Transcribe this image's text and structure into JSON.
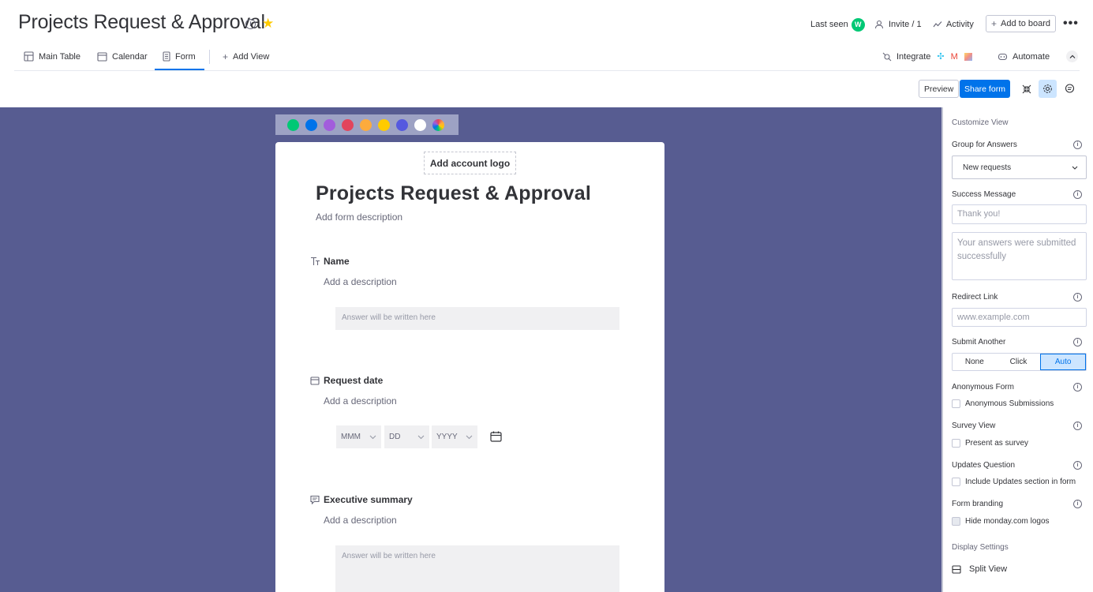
{
  "header": {
    "title": "Projects Request & Approval",
    "last_seen_label": "Last seen",
    "avatar_initial": "W",
    "invite_label": "Invite / 1",
    "activity_label": "Activity",
    "add_to_board_label": "Add to board",
    "more_label": "•••"
  },
  "tabs": [
    {
      "label": "Main Table",
      "icon": "table-icon"
    },
    {
      "label": "Calendar",
      "icon": "calendar-icon"
    },
    {
      "label": "Form",
      "icon": "form-icon",
      "active": true
    },
    {
      "label": "Add View",
      "icon": "plus-icon"
    }
  ],
  "toolbar": {
    "integrate_label": "Integrate",
    "automate_label": "Automate",
    "preview_label": "Preview",
    "share_label": "Share form"
  },
  "palette": {
    "colors": [
      "#00c875",
      "#0073ea",
      "#a25ddc",
      "#e2445c",
      "#fdab3d",
      "#ffcb00",
      "#5559df",
      "#ffffff"
    ]
  },
  "form": {
    "logo_label": "Add account logo",
    "title": "Projects Request & Approval",
    "description": "Add form description",
    "questions": [
      {
        "label": "Name",
        "description": "Add a description",
        "placeholder": "Answer will be written here"
      },
      {
        "label": "Request date",
        "description": "Add a description",
        "month": "MMM",
        "day": "DD",
        "year": "YYYY"
      },
      {
        "label": "Executive summary",
        "description": "Add a description",
        "placeholder": "Answer will be written here"
      }
    ]
  },
  "panel": {
    "customize_title": "Customize View",
    "group_label": "Group for Answers",
    "group_value": "New requests",
    "success_label": "Success Message",
    "success_title_placeholder": "Thank you!",
    "success_body_placeholder": "Your answers were submitted successfully",
    "redirect_label": "Redirect Link",
    "redirect_placeholder": "www.example.com",
    "submit_another_label": "Submit Another",
    "submit_options": [
      "None",
      "Click",
      "Auto"
    ],
    "submit_selected": "Auto",
    "anonymous_label": "Anonymous Form",
    "anonymous_option": "Anonymous Submissions",
    "survey_label": "Survey View",
    "survey_option": "Present as survey",
    "updates_label": "Updates Question",
    "updates_option": "Include Updates section in form",
    "branding_label": "Form branding",
    "branding_option": "Hide monday.com logos",
    "display_title": "Display Settings",
    "split_view_label": "Split View"
  }
}
